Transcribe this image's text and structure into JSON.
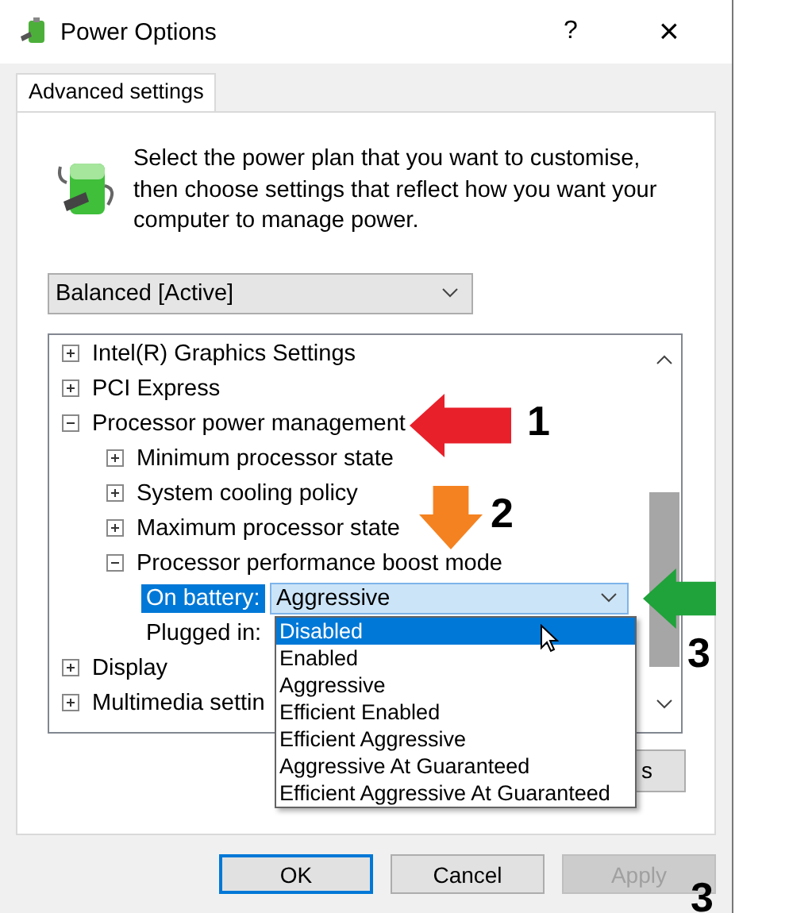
{
  "window": {
    "title": "Power Options",
    "help": "?",
    "close": "×"
  },
  "tabs": [
    {
      "label": "Advanced settings",
      "selected": true
    }
  ],
  "description": "Select the power plan that you want to customise, then choose settings that reflect how you want your computer to manage power.",
  "plan_select": {
    "value": "Balanced [Active]"
  },
  "settings_tree": [
    {
      "label": "Intel(R) Graphics Settings",
      "expanded": false
    },
    {
      "label": "PCI Express",
      "expanded": false
    },
    {
      "label": "Processor power management",
      "expanded": true,
      "children": [
        {
          "label": "Minimum processor state",
          "expanded": false
        },
        {
          "label": "System cooling policy",
          "expanded": false
        },
        {
          "label": "Maximum processor state",
          "expanded": false
        },
        {
          "label": "Processor performance boost mode",
          "expanded": true,
          "values": [
            {
              "label": "On battery:",
              "selected": true,
              "value": "Aggressive"
            },
            {
              "label": "Plugged in:",
              "selected": false
            }
          ]
        }
      ]
    },
    {
      "label": "Display",
      "expanded": false
    },
    {
      "label": "Multimedia settin",
      "expanded": false
    }
  ],
  "dropdown_list": [
    {
      "label": "Disabled",
      "selected": true
    },
    {
      "label": "Enabled",
      "selected": false
    },
    {
      "label": "Aggressive",
      "selected": false
    },
    {
      "label": "Efficient Enabled",
      "selected": false
    },
    {
      "label": "Efficient Aggressive",
      "selected": false
    },
    {
      "label": "Aggressive At Guaranteed",
      "selected": false
    },
    {
      "label": "Efficient Aggressive At Guaranteed",
      "selected": false
    }
  ],
  "restore_button": {
    "label": "s"
  },
  "buttons": [
    {
      "label": "OK",
      "default": true,
      "disabled": false
    },
    {
      "label": "Cancel",
      "default": false,
      "disabled": false
    },
    {
      "label": "Apply",
      "default": false,
      "disabled": true
    }
  ],
  "annotations": [
    {
      "kind": "arrow-left",
      "color": "#e8202a",
      "label": "1"
    },
    {
      "kind": "arrow-down",
      "color": "#f58220",
      "label": "2"
    },
    {
      "kind": "arrow-left",
      "color": "#1fa33a",
      "label": "3"
    },
    {
      "kind": "number",
      "label": "3"
    }
  ]
}
